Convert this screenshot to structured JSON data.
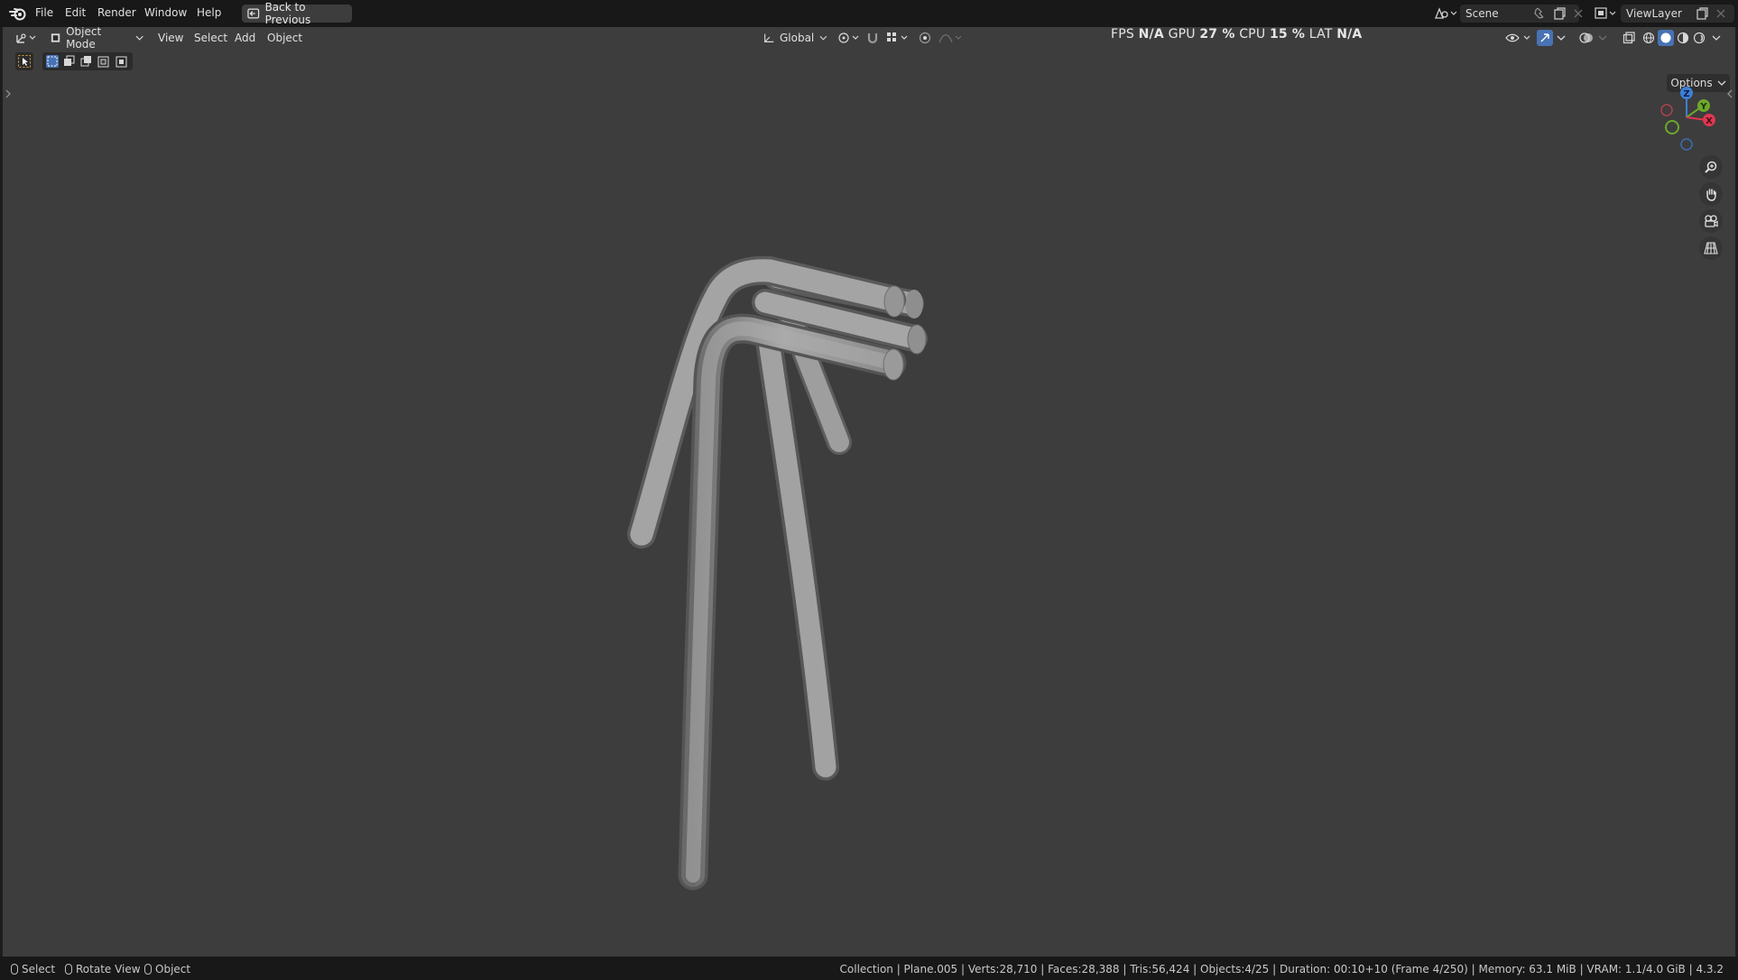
{
  "menubar": {
    "items": [
      "File",
      "Edit",
      "Render",
      "Window",
      "Help"
    ],
    "back_button": "Back to Previous",
    "scene": "Scene",
    "view_layer": "ViewLayer"
  },
  "viewport_header": {
    "mode": "Object Mode",
    "menus": [
      "View",
      "Select",
      "Add",
      "Object"
    ],
    "transform_orientation": "Global",
    "stats": {
      "fps_label": "FPS",
      "fps_value": "N/A",
      "gpu_label": "GPU",
      "gpu_value": "27 %",
      "cpu_label": "CPU",
      "cpu_value": "15 %",
      "lat_label": "LAT",
      "lat_value": "N/A"
    },
    "options_label": "Options"
  },
  "gizmo": {
    "z": "Z",
    "y": "Y",
    "x": "X",
    "colors": {
      "x": "#e0374f",
      "y": "#6ea72b",
      "z": "#3d7fd8"
    }
  },
  "statusbar": {
    "hint_select": "Select",
    "hint_rotate": "Rotate View",
    "hint_object": "Object",
    "info": "Collection | Plane.005 | Verts:28,710 | Faces:28,388 | Tris:56,424 | Objects:4/25 | Duration: 00:10+10 (Frame 4/250) | Memory: 63.1 MiB | VRAM: 1.1/4.0 GiB | 4.3.2"
  }
}
